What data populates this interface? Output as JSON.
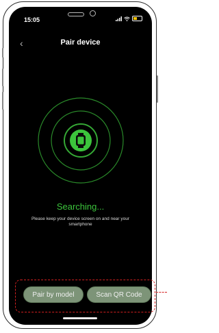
{
  "status_bar": {
    "time": "15:05"
  },
  "header": {
    "back_glyph": "‹",
    "title": "Pair device"
  },
  "search": {
    "status": "Searching...",
    "hint": "Please keep your device screen on and near your smartphone"
  },
  "actions": {
    "pair_by_model": "Pair by model",
    "scan_qr_code": "Scan QR Code"
  },
  "colors": {
    "screen_bg": "#000000",
    "accent_green": "#3cc43c",
    "button_bg": "#7d9478",
    "annotation_red": "#d42020"
  },
  "icons": {
    "back": "chevron-left-icon",
    "watch": "smartwatch-icon",
    "signal": "cellular-signal-icon",
    "wifi": "wifi-icon",
    "battery": "battery-icon"
  }
}
